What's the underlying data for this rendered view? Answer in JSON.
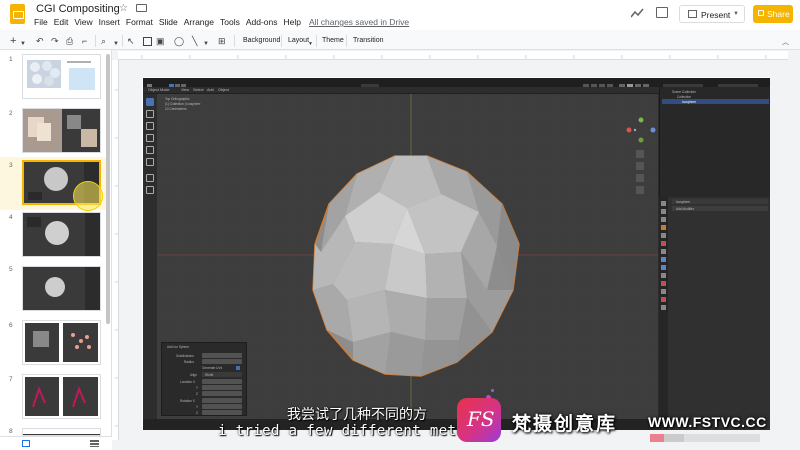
{
  "app": {
    "doc_title": "CGI Compositing",
    "menu": [
      "File",
      "Edit",
      "View",
      "Insert",
      "Format",
      "Slide",
      "Arrange",
      "Tools",
      "Add-ons",
      "Help"
    ],
    "save_status": "All changes saved in Drive",
    "present_label": "Present",
    "share_label": "Share",
    "accent_color": "#f4b400"
  },
  "toolbar": {
    "background_label": "Background",
    "layout_label": "Layout",
    "theme_label": "Theme",
    "transition_label": "Transition"
  },
  "slides": {
    "numbers": [
      "1",
      "2",
      "3",
      "4",
      "5",
      "6",
      "7",
      "8"
    ],
    "active": "3"
  },
  "blender": {
    "object_mode_label": "Object Mode",
    "header_menu": [
      "View",
      "Select",
      "Add",
      "Object"
    ],
    "overlay_lines": [
      "Top Orthographic",
      "(1) Collection | Icosphere",
      "10 Centimeters"
    ],
    "outliner_header": "Scene Collection",
    "outliner_items": [
      "Collection",
      "Icosphere"
    ],
    "props_object": "Icosphere",
    "props_add_modifier": "Add Modifier",
    "panel_title": "Add Ico Sphere",
    "panel_rows": [
      "Subdivisions",
      "Radius",
      "Generate UVs",
      "Align",
      "Location X",
      "Y",
      "Z",
      "Rotation X",
      "Y",
      "Z"
    ],
    "align_value": "World"
  },
  "subtitles": {
    "chinese": "我尝试了几种不同的方",
    "english": "i tried a few different method"
  },
  "watermark": {
    "logo_text": "FS",
    "site_name": "梵摄创意库",
    "url": "WWW.FSTVC.CC"
  }
}
